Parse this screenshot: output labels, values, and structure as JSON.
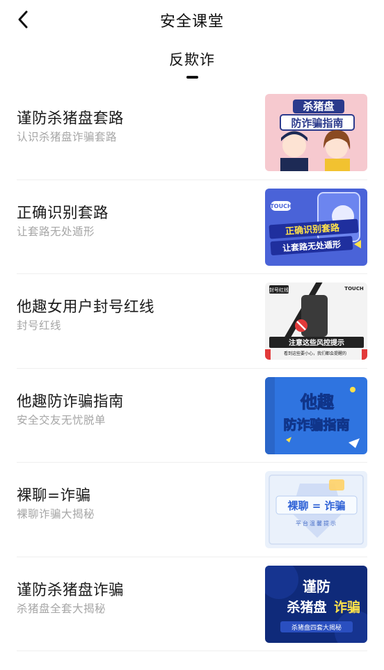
{
  "header": {
    "title": "安全课堂",
    "back_icon": "chevron-left-icon"
  },
  "tab": {
    "label": "反欺诈"
  },
  "items": [
    {
      "title": "谨防杀猪盘套路",
      "subtitle": "认识杀猪盘诈骗套路",
      "thumb": {
        "line1": "杀猪盘",
        "line2": "防诈骗指南",
        "bg": "#f6c9cf"
      }
    },
    {
      "title": "正确识别套路",
      "subtitle": "让套路无处遁形",
      "thumb": {
        "badge": "TOUCH",
        "line1": "正确识别套路",
        "line2": "让套路无处遁形",
        "bg": "#4a63d8"
      }
    },
    {
      "title": "他趣女用户封号红线",
      "subtitle": "封号红线",
      "thumb": {
        "tag": "封号红线",
        "corner": "TOUCH",
        "banner": "注意这些风控提示",
        "footer": "看到这些要小心，我们都会提醒的",
        "bg": "#f3f3f3"
      }
    },
    {
      "title": "他趣防诈骗指南",
      "subtitle": "安全交友无忧脱单",
      "thumb": {
        "line1": "他趣",
        "line2": "防诈骗指南",
        "bg": "#2f74e0"
      }
    },
    {
      "title": "裸聊=诈骗",
      "subtitle": "裸聊诈骗大揭秘",
      "thumb": {
        "line1": "裸聊 = 诈骗",
        "line2": "平台温馨提示",
        "bg": "#eaf1fb"
      }
    },
    {
      "title": "谨防杀猪盘诈骗",
      "subtitle": "杀猪盘全套大揭秘",
      "thumb": {
        "line1": "谨防",
        "line2a": "杀猪盘",
        "line2b": "诈骗",
        "footer": "杀猪盘四套大揭秘",
        "bg": "#0f2a7a"
      }
    }
  ]
}
